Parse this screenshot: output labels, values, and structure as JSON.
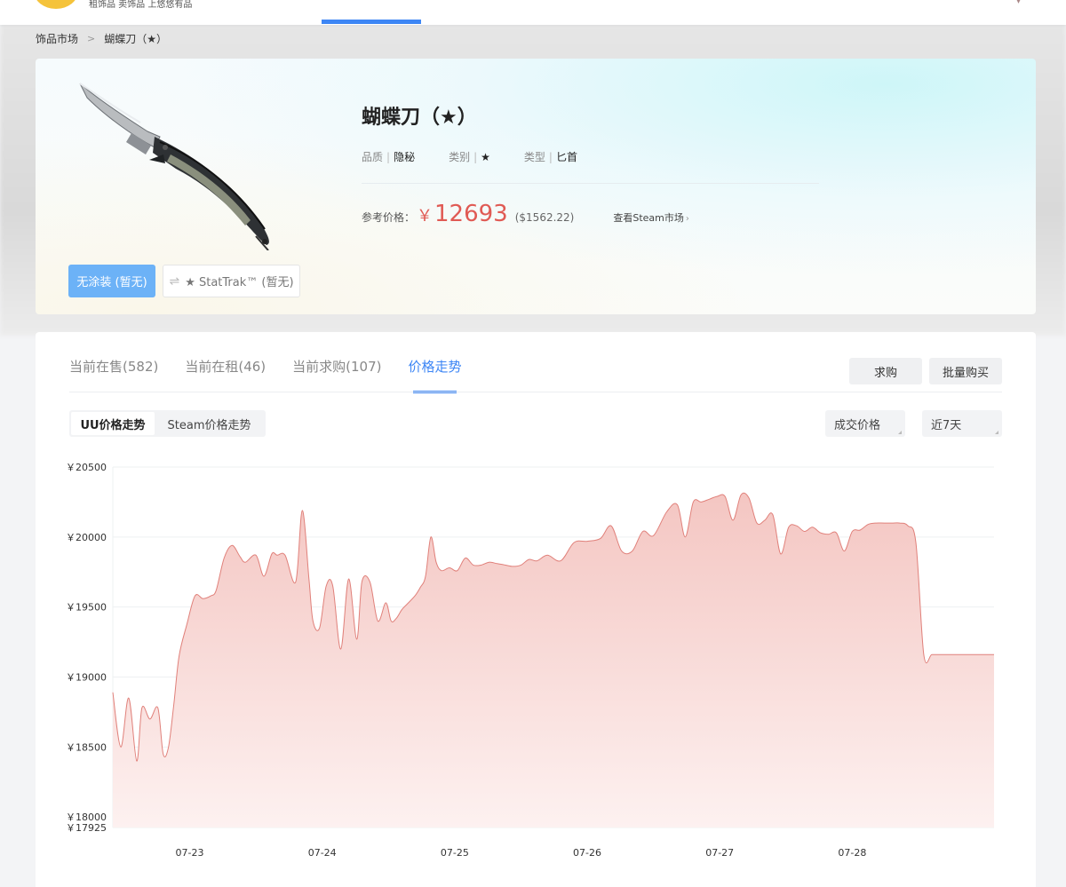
{
  "header": {
    "tagline": "租饰品 卖饰品 上悠悠有品",
    "active_nav_color": "#3d86f5"
  },
  "breadcrumb": {
    "items": [
      "饰品市场",
      "蝴蝶刀（★）"
    ],
    "separator": ">"
  },
  "product": {
    "title": "蝴蝶刀（★）",
    "attributes": [
      {
        "key": "品质",
        "value": "隐秘"
      },
      {
        "key": "类别",
        "value": "★"
      },
      {
        "key": "类型",
        "value": "匕首"
      }
    ],
    "price_label": "参考价格：",
    "price_currency": "￥",
    "price_value": "12693",
    "price_usd": "($1562.22)",
    "steam_link": "查看Steam市场",
    "variants": [
      {
        "label": "无涂装 (暂无)",
        "active": true
      },
      {
        "label": "★ StatTrak™ (暂无)",
        "active": false
      }
    ],
    "icon": "butterfly-knife-image"
  },
  "tabs": [
    {
      "label": "当前在售(582)",
      "active": false
    },
    {
      "label": "当前在租(46)",
      "active": false
    },
    {
      "label": "当前求购(107)",
      "active": false
    },
    {
      "label": "价格走势",
      "active": true
    }
  ],
  "actions": {
    "buy_request": "求购",
    "bulk_buy": "批量购买"
  },
  "trend": {
    "source_options": [
      "UU价格走势",
      "Steam价格走势"
    ],
    "source_active": "UU价格走势",
    "price_type": "成交价格",
    "range": "近7天"
  },
  "chart_data": {
    "type": "area",
    "y_prefix": "￥",
    "yticks": [
      20500,
      20000,
      19500,
      19000,
      18500,
      18000,
      17925
    ],
    "ylim": [
      17925,
      20500
    ],
    "xticks": [
      "07-23",
      "07-24",
      "07-25",
      "07-26",
      "07-27",
      "07-28"
    ],
    "xlim": [
      22.42,
      29.07
    ],
    "line_color": "#e0807a",
    "fill_color_top": "#f4c6c2",
    "fill_color_bottom": "#fdf1f0",
    "series": [
      {
        "x": [
          22.42,
          22.48,
          22.54,
          22.6,
          22.64,
          22.7,
          22.76,
          22.8,
          22.84,
          22.88,
          22.92,
          22.98,
          23.04,
          23.1,
          23.16,
          23.2,
          23.26,
          23.32,
          23.38,
          23.42,
          23.5,
          23.56,
          23.62,
          23.66,
          23.72,
          23.8,
          23.85,
          23.9,
          23.93,
          23.98,
          24.03,
          24.08,
          24.14,
          24.2,
          24.26,
          24.3,
          24.36,
          24.42,
          24.48,
          24.52,
          24.56,
          24.6,
          24.64,
          24.7,
          24.74,
          24.78,
          24.82,
          24.86,
          24.9,
          24.96,
          25.02,
          25.08,
          25.14,
          25.2,
          25.26,
          25.32,
          25.38,
          25.44,
          25.5,
          25.56,
          25.62,
          25.7,
          25.8,
          25.9,
          26.0,
          26.1,
          26.18,
          26.26,
          26.34,
          26.42,
          26.5,
          26.6,
          26.68,
          26.74,
          26.8,
          26.86,
          26.92,
          26.98,
          27.04,
          27.1,
          27.16,
          27.22,
          27.28,
          27.34,
          27.4,
          27.46,
          27.52,
          27.58,
          27.64,
          27.7,
          27.76,
          27.82,
          27.88,
          27.94,
          28.0,
          28.06,
          28.12,
          28.18,
          28.24,
          28.3,
          28.36,
          28.42,
          28.48,
          28.54,
          28.6,
          28.66,
          28.72,
          28.78,
          28.84,
          28.9,
          28.96,
          29.02,
          29.07
        ],
        "y": [
          18890,
          18500,
          18850,
          18400,
          18780,
          18700,
          18780,
          18450,
          18500,
          18800,
          19150,
          19380,
          19580,
          19560,
          19580,
          19620,
          19850,
          19940,
          19860,
          19820,
          19870,
          19720,
          19880,
          19870,
          19870,
          19680,
          20190,
          19700,
          19400,
          19350,
          19650,
          19650,
          19200,
          19700,
          19270,
          19680,
          19680,
          19400,
          19530,
          19400,
          19420,
          19480,
          19520,
          19580,
          19640,
          19720,
          20000,
          19820,
          19760,
          19780,
          19760,
          19850,
          19800,
          19800,
          19820,
          19810,
          19800,
          19790,
          19800,
          19840,
          19830,
          19870,
          19830,
          19960,
          19970,
          19990,
          20080,
          19900,
          19900,
          20040,
          20010,
          20180,
          20230,
          20000,
          20250,
          20250,
          20270,
          20290,
          20290,
          20120,
          20300,
          20280,
          20100,
          20120,
          20160,
          19880,
          20070,
          20080,
          20040,
          20070,
          20030,
          20020,
          20030,
          19900,
          20040,
          20050,
          20090,
          20100,
          20100,
          20100,
          20100,
          20080,
          19960,
          19160,
          19160,
          19160,
          19160,
          19160,
          19160,
          19160,
          19160,
          19160,
          19160
        ]
      }
    ]
  }
}
